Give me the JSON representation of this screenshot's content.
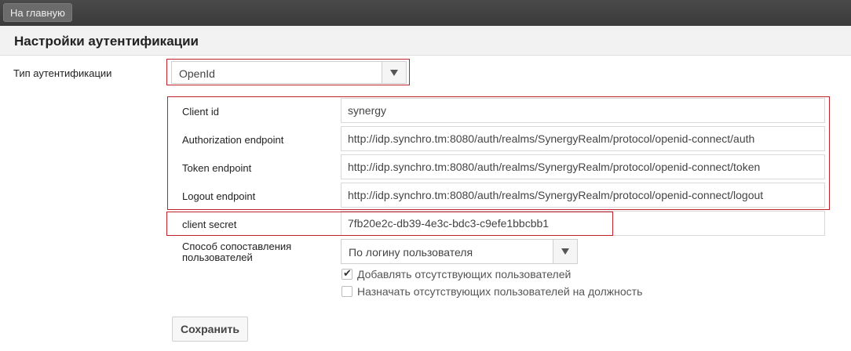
{
  "nav": {
    "home_label": "На главную"
  },
  "page": {
    "title": "Настройки аутентификации"
  },
  "auth_type": {
    "label": "Тип аутентификации",
    "value": "OpenId"
  },
  "openid": {
    "client_id": {
      "label": "Client id",
      "value": "synergy"
    },
    "authorization_endpoint": {
      "label": "Authorization endpoint",
      "value": "http://idp.synchro.tm:8080/auth/realms/SynergyRealm/protocol/openid-connect/auth"
    },
    "token_endpoint": {
      "label": "Token endpoint",
      "value": "http://idp.synchro.tm:8080/auth/realms/SynergyRealm/protocol/openid-connect/token"
    },
    "logout_endpoint": {
      "label": "Logout endpoint",
      "value": "http://idp.synchro.tm:8080/auth/realms/SynergyRealm/protocol/openid-connect/logout"
    },
    "client_secret": {
      "label": "client secret",
      "value": "7fb20e2c-db39-4e3c-bdc3-c9efe1bbcbb1"
    }
  },
  "matching": {
    "label_line1": "Способ сопоставления",
    "label_line2": "пользователей",
    "value": "По логину пользователя"
  },
  "options": {
    "add_missing": {
      "label": "Добавлять отсутствующих пользователей",
      "checked": true
    },
    "assign_missing": {
      "label": "Назначать отсутствующих пользователей на должность",
      "checked": false
    }
  },
  "actions": {
    "save_label": "Сохранить"
  },
  "colors": {
    "highlight": "#c0202a",
    "topbar": "#3a3a3a"
  }
}
